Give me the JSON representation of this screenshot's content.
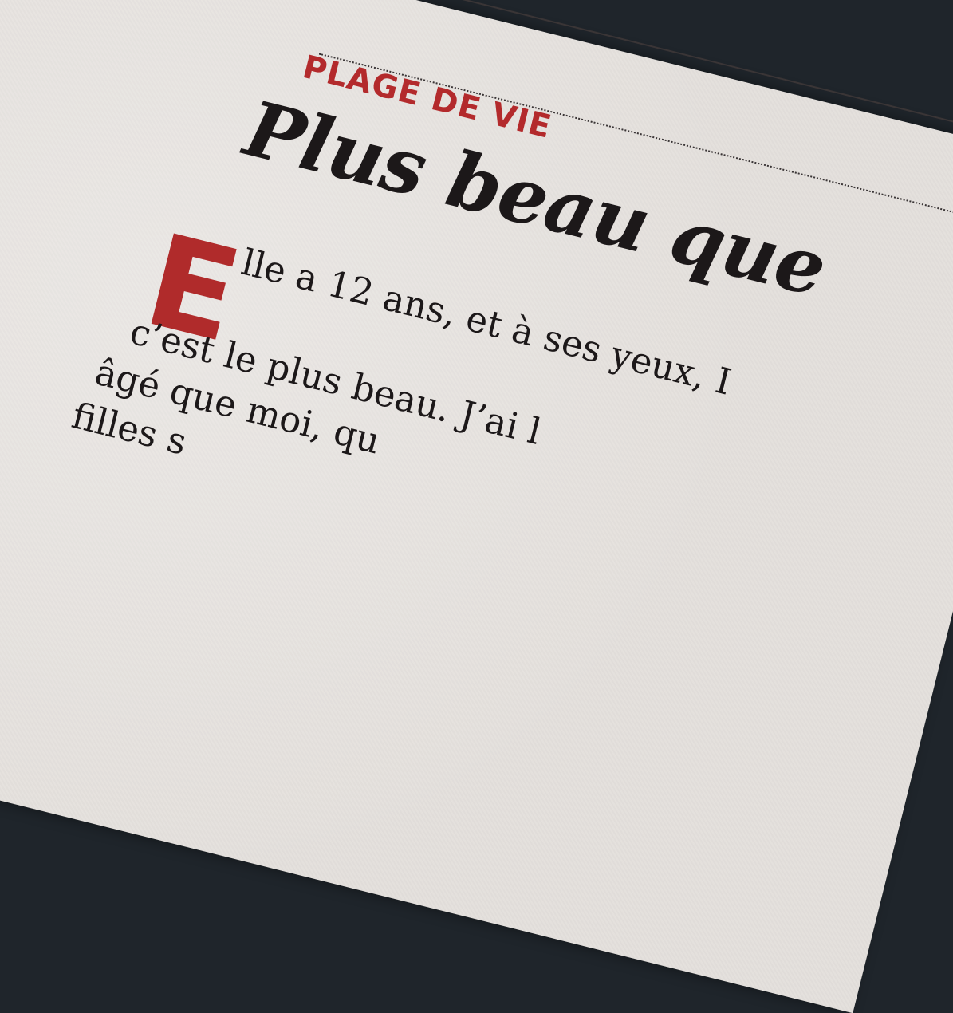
{
  "article": {
    "kicker": "PLAGE DE VIE",
    "headline": "Plus beau que",
    "dropcap": "E",
    "lines": [
      "lle a 12 ans, et à ses yeux, I",
      "c’est le plus beau. J’ai l",
      "âgé que moi, qu",
      "filles s"
    ]
  },
  "colors": {
    "accent_red": "#b32a2c",
    "ink": "#1c1819",
    "paper": "#e4e0dc"
  }
}
